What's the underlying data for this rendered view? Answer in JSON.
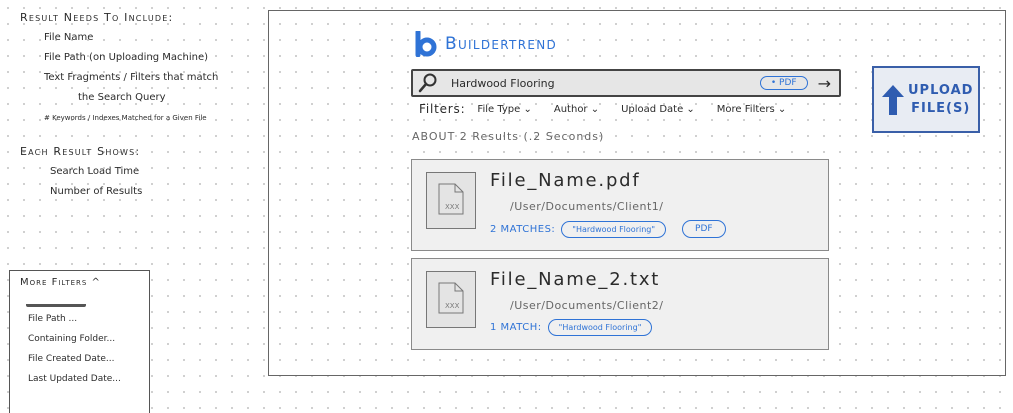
{
  "notes": {
    "heading1": "Result Needs To Include:",
    "items1": [
      "File Name",
      "File Path (on Uploading Machine)",
      "Text Fragments / Filters that match",
      "the Search Query",
      "# Keywords / Indexes Matched for a Given File"
    ],
    "heading2": "Each Result Shows:",
    "items2": [
      "Search Load Time",
      "Number of Results"
    ]
  },
  "more_filters": {
    "title": "More Filters ^",
    "options": [
      "File Path ...",
      "Containing Folder...",
      "File Created Date...",
      "Last Updated Date..."
    ]
  },
  "brand": {
    "name": "Buildertrend",
    "color": "#2f73d6"
  },
  "search": {
    "icon": "magnifier-icon",
    "query": "Hardwood Flooring",
    "tag": "PDF",
    "submit_icon": "arrow-right-icon"
  },
  "upload": {
    "line1": "UPLOAD",
    "line2": "FILE(S)",
    "icon": "arrow-up-icon"
  },
  "filters": {
    "label": "Filters:",
    "options": [
      "File Type",
      "Author",
      "Upload Date",
      "More Filters"
    ]
  },
  "summary": "ABOUT 2 Results (.2 Seconds)",
  "results": [
    {
      "thumb_label": "XXX",
      "name": "File_Name.pdf",
      "path": "/User/Documents/Client1/",
      "matches": "2 MATCHES:",
      "keyword": "\"Hardwood Flooring\"",
      "tag": "PDF"
    },
    {
      "thumb_label": "XXX",
      "name": "File_Name_2.txt",
      "path": "/User/Documents/Client2/",
      "matches": "1 MATCH:",
      "keyword": "\"Hardwood Flooring\""
    }
  ]
}
